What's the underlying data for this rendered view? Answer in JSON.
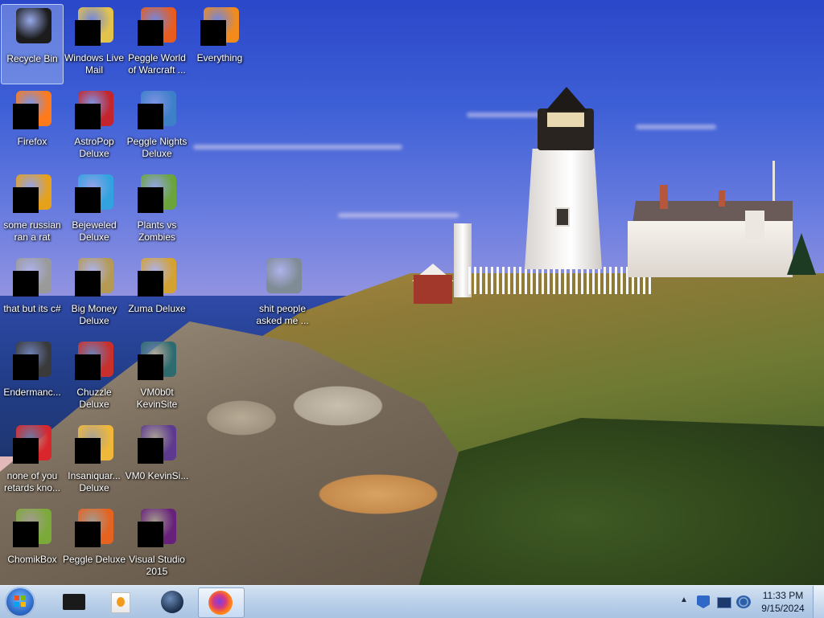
{
  "desktop": {
    "icons": [
      {
        "label": "Recycle Bin",
        "icon": "recycle-bin-icon",
        "color": "#1c1c1c",
        "selected": true
      },
      {
        "label": "Windows Live Mail",
        "icon": "windows-live-mail-icon",
        "color": "#e3c34b"
      },
      {
        "label": "Peggle World of Warcraft ...",
        "icon": "peggle-wow-icon",
        "color": "#e85d1f"
      },
      {
        "label": "Everything",
        "icon": "everything-icon",
        "color": "#f28b1c"
      },
      {
        "label": "Firefox",
        "icon": "firefox-icon",
        "color": "#ff7a1a"
      },
      {
        "label": "AstroPop Deluxe",
        "icon": "astropop-icon",
        "color": "#c4242b"
      },
      {
        "label": "Peggle Nights Deluxe",
        "icon": "peggle-nights-icon",
        "color": "#3e7fc9"
      },
      {
        "label": "some russian ran a rat",
        "icon": "some-russian-icon",
        "color": "#e6a11c"
      },
      {
        "label": "Bejeweled Deluxe",
        "icon": "bejeweled-icon",
        "color": "#33a3e0"
      },
      {
        "label": "Plants vs Zombies",
        "icon": "plants-vs-zombies-icon",
        "color": "#6aa43a"
      },
      {
        "label": "that but its c#",
        "icon": "c-sharp-icon",
        "color": "#9a9a9a"
      },
      {
        "label": "Big Money Deluxe",
        "icon": "big-money-icon",
        "color": "#b59a55"
      },
      {
        "label": "Zuma Deluxe",
        "icon": "zuma-icon",
        "color": "#d4a231"
      },
      {
        "label": "shit people asked me ...",
        "icon": "folder-icon",
        "color": "#7f8b95"
      },
      {
        "label": "Endermanc...",
        "icon": "endermanch-icon",
        "color": "#3a3a3a"
      },
      {
        "label": "Chuzzle Deluxe",
        "icon": "chuzzle-icon",
        "color": "#c9302c"
      },
      {
        "label": "VM0b0t KevinSite",
        "icon": "vm0b0t-icon",
        "color": "#2e6b6e"
      },
      {
        "label": "none of you retards kno...",
        "icon": "opera-icon",
        "color": "#d9262c"
      },
      {
        "label": "Insaniquar... Deluxe",
        "icon": "insaniquarium-icon",
        "color": "#f0b83a"
      },
      {
        "label": "VM0 KevinSi...",
        "icon": "vm0-icon",
        "color": "#5d3a8f"
      },
      {
        "label": "ChomikBox",
        "icon": "chomikbox-icon",
        "color": "#7caa3a"
      },
      {
        "label": "Peggle Deluxe",
        "icon": "peggle-deluxe-icon",
        "color": "#e6621f"
      },
      {
        "label": "Visual Studio 2015",
        "icon": "visual-studio-icon",
        "color": "#68217a"
      }
    ]
  },
  "taskbar": {
    "start_icon": "windows-start-icon",
    "pinned": [
      {
        "name": "tb-explorer",
        "icon": "explorer-icon",
        "active": false
      },
      {
        "name": "tb-media",
        "icon": "media-player-icon",
        "active": false
      },
      {
        "name": "tb-globe",
        "icon": "globe-icon",
        "active": false
      },
      {
        "name": "tb-firefox",
        "icon": "firefox-icon",
        "active": true
      }
    ],
    "tray": {
      "chevron": "▲",
      "icons": [
        "action-center-icon",
        "network-icon",
        "volume-icon"
      ]
    },
    "clock": {
      "time": "11:33 PM",
      "date": "9/15/2024"
    }
  }
}
